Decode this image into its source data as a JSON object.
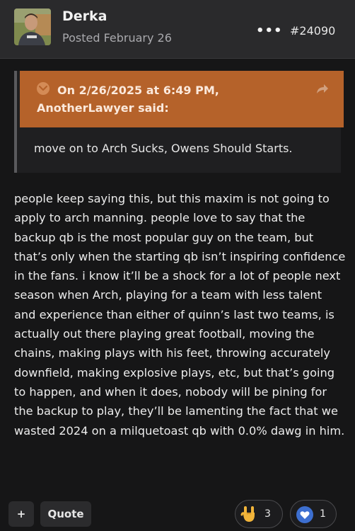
{
  "post": {
    "author": "Derka",
    "posted": "Posted February 26",
    "more_icon": "more-dots-icon",
    "more_label": "•••",
    "post_number": "#24090"
  },
  "quote": {
    "cite": "On 2/26/2025 at 6:49 PM, AnotherLawyer said:",
    "text": "move on to Arch Sucks, Owens Should Starts.",
    "colors": {
      "header": "#b5622a",
      "body": "#1f1f21"
    }
  },
  "body": "people keep saying this, but this maxim is not going to apply to arch manning. people love to say that the backup qb is the most popular guy on the team, but that’s only when the starting qb isn’t inspiring confidence in the fans. i know it’ll be a shock for a lot of people next season when Arch, playing for a team with less talent and experience than either of quinn’s last two teams, is actually out there playing great football, moving the chains, making plays with his feet, throwing accurately downfield, making explosive plays, etc, but that’s going to happen, and when it does, nobody will be pining for the backup to play, they’ll be lamenting the fact that we wasted 2024 on a milquetoast qb with 0.0% dawg in him.",
  "actions": {
    "plus_label": "+",
    "quote_label": "Quote"
  },
  "reactions": [
    {
      "icon": "rock-on-hand-icon",
      "count": "3"
    },
    {
      "icon": "heart-icon",
      "count": "1"
    }
  ],
  "colors": {
    "page_bg": "#161617",
    "header_bg": "#2a2a2c",
    "accent": "#b5622a"
  }
}
